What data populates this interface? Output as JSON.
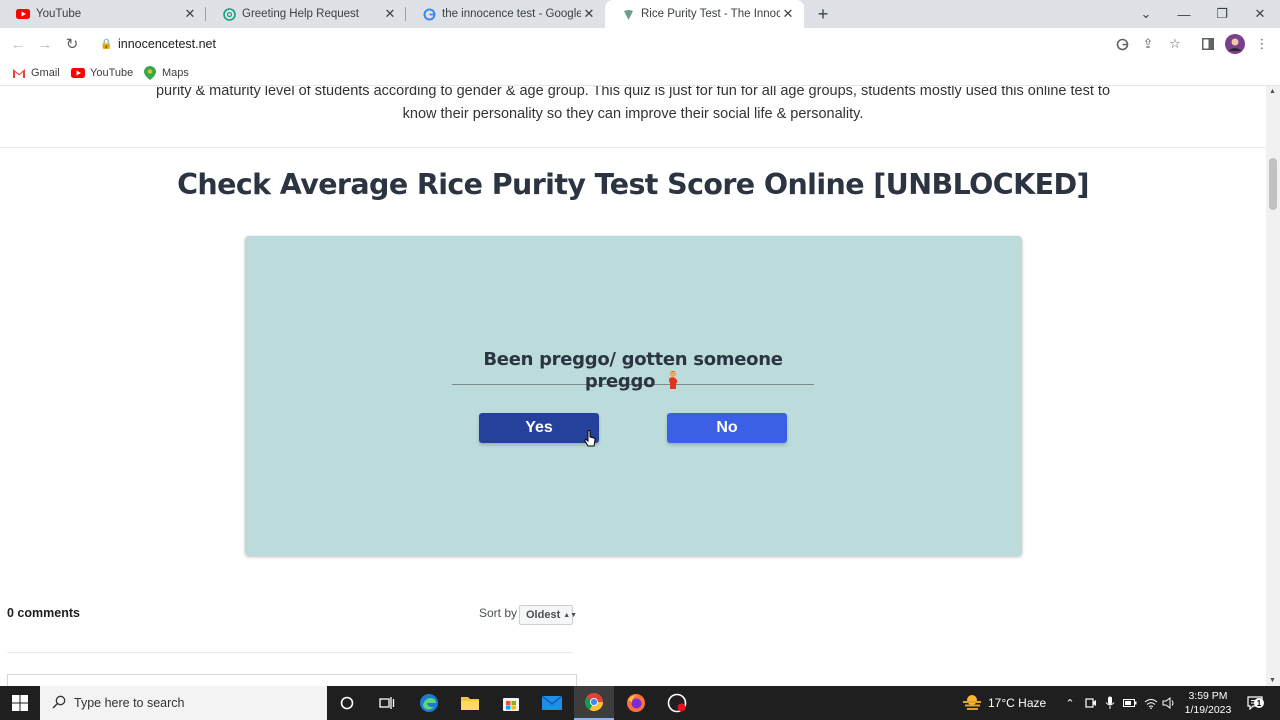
{
  "browser": {
    "tabs": [
      {
        "title": "YouTube",
        "icon": "youtube-icon",
        "active": false
      },
      {
        "title": "Greeting Help Request",
        "icon": "chatgpt-icon",
        "active": false
      },
      {
        "title": "the innocence test - Google Sear",
        "icon": "google-icon",
        "active": false
      },
      {
        "title": "Rice Purity Test - The Innocence T",
        "icon": "rice-purity-icon",
        "active": true
      }
    ],
    "url": "innocencetest.net",
    "bookmarks": [
      {
        "label": "Gmail",
        "icon": "gmail-icon"
      },
      {
        "label": "YouTube",
        "icon": "youtube-icon"
      },
      {
        "label": "Maps",
        "icon": "maps-icon"
      }
    ]
  },
  "page": {
    "intro_line1": "purity & maturity level of students according to gender & age group. This quiz is just for fun for all age groups, students mostly used this online test to",
    "intro_line2": "know their personality so they can improve their social life & personality.",
    "heading": "Check Average Rice Purity Test Score Online [UNBLOCKED]",
    "quiz": {
      "question": "Been preggo/ gotten someone preggo",
      "question_emoji": "pregnant-woman-emoji",
      "yes_label": "Yes",
      "no_label": "No"
    },
    "comments": {
      "count_label": "0 comments",
      "sort_label": "Sort by",
      "sort_value": "Oldest"
    }
  },
  "taskbar": {
    "search_placeholder": "Type here to search",
    "weather": "17°C  Haze",
    "time": "3:59 PM",
    "date": "1/19/2023"
  },
  "colors": {
    "quiz_card": "#bcdcdb",
    "yes_button": "#26419b",
    "no_button": "#3b5fe5",
    "heading_text": "#2b3440"
  }
}
